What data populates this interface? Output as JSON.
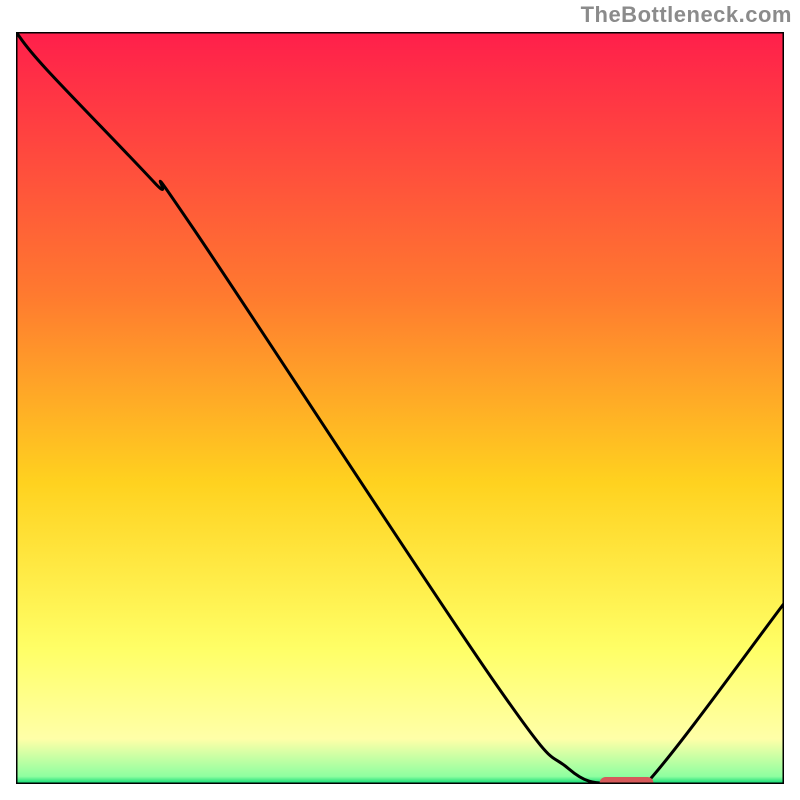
{
  "attribution": "TheBottleneck.com",
  "colors": {
    "curve": "#000000",
    "marker": "#d65a5a",
    "border": "#000000"
  },
  "chart_data": {
    "type": "line",
    "title": "",
    "xlabel": "",
    "ylabel": "",
    "xlim": [
      0,
      100
    ],
    "ylim": [
      0,
      100
    ],
    "grid": false,
    "legend": false,
    "note": "No axis ticks or numeric labels are rendered; values estimated from geometry with x,y normalized to 0–100.",
    "series": [
      {
        "name": "bottleneck-curve",
        "x": [
          0.0,
          4.0,
          18.0,
          23.0,
          62.0,
          72.0,
          78.0,
          82.0,
          100.0
        ],
        "y": [
          100.0,
          95.0,
          80.0,
          74.0,
          14.0,
          2.0,
          0.0,
          0.0,
          24.0
        ],
        "color": "#000000"
      }
    ],
    "marker": {
      "name": "optimal-range",
      "shape": "rounded-bar",
      "x_start": 76.0,
      "x_end": 83.0,
      "y": 0.0,
      "color": "#d65a5a"
    },
    "background_gradient": {
      "type": "vertical",
      "stops": [
        {
          "y": 100,
          "color": "#ff1f4b"
        },
        {
          "y": 65,
          "color": "#ff7a2f"
        },
        {
          "y": 40,
          "color": "#ffd21f"
        },
        {
          "y": 18,
          "color": "#ffff66"
        },
        {
          "y": 6,
          "color": "#ffffa8"
        },
        {
          "y": 1,
          "color": "#8effa0"
        },
        {
          "y": 0,
          "color": "#00d66f"
        }
      ]
    }
  }
}
